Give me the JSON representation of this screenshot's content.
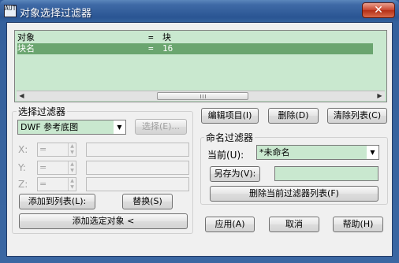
{
  "window": {
    "title": "对象选择过滤器",
    "close_glyph": "✕",
    "app_icon_text": "AUTO"
  },
  "filter_list": {
    "rows": [
      {
        "col1": "对象",
        "col2": "=",
        "col3": "块",
        "selected": false
      },
      {
        "col1": "块名",
        "col2": "=",
        "col3": "16",
        "selected": true
      }
    ],
    "scroll_left_glyph": "◀",
    "scroll_right_glyph": "▶"
  },
  "select_filter": {
    "legend": "选择过滤器",
    "type_value": "DWF 参考底图",
    "select_button": "选择(E)...",
    "x_label": "X:",
    "y_label": "Y:",
    "z_label": "Z:",
    "op_value": "=",
    "add_to_list_button": "添加到列表(L):",
    "replace_button": "替换(S)",
    "add_selected_button": "添加选定对象 <"
  },
  "list_buttons": {
    "edit": "编辑项目(I)",
    "delete": "删除(D)",
    "clear": "清除列表(C)"
  },
  "named_filters": {
    "legend": "命名过滤器",
    "current_label": "当前(U):",
    "current_value": "*未命名",
    "save_as_button": "另存为(V):",
    "save_as_value": "",
    "delete_current_button": "删除当前过滤器列表(F)"
  },
  "dialog_buttons": {
    "apply": "应用(A)",
    "cancel": "取消",
    "help": "帮助(H)"
  },
  "icons": {
    "dropdown": "▼",
    "spin_up": "▲",
    "spin_down": "▼"
  },
  "colors": {
    "list_bg": "#c9e8cf",
    "selected_row": "#6aa56f",
    "title_bar": "#2a5593",
    "close_button": "#c8432b"
  }
}
